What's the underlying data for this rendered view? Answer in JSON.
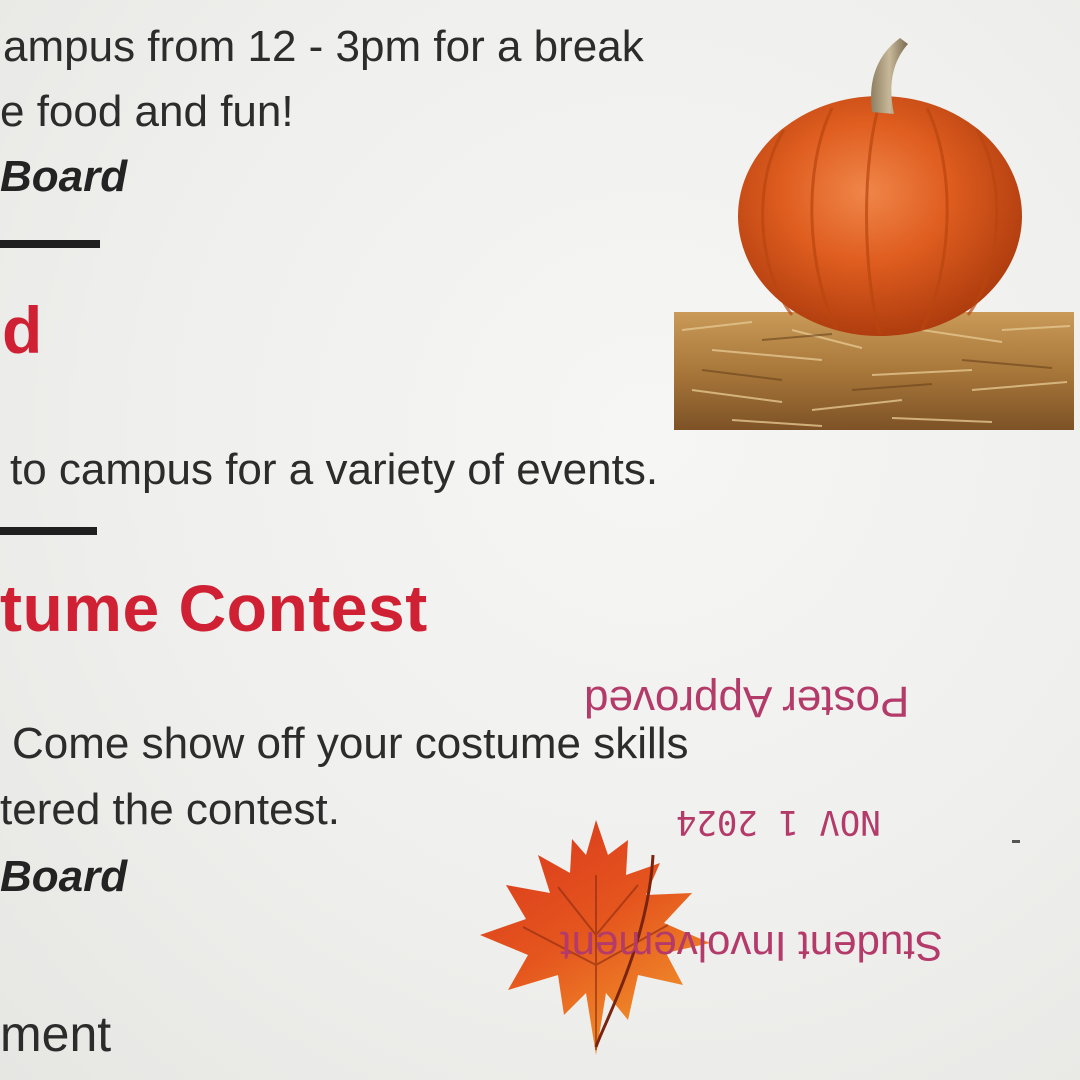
{
  "flyer": {
    "section1": {
      "line1": "ampus from 12 - 3pm for a break",
      "line2": "e food and fun!",
      "signature": "Board"
    },
    "section2": {
      "heading": "d",
      "line1": "to campus for a variety of events."
    },
    "section3": {
      "heading": "tume Contest",
      "line1": "Come show off your costume skills",
      "line2": "tered the contest.",
      "signature": "Board"
    },
    "footer_fragment": "ment"
  },
  "stamp": {
    "approval": "Poster Approved",
    "date": "NOV  1 2024",
    "office": "Student Involvement",
    "orientation": "upside-down",
    "color": "#b43a6a"
  },
  "images": {
    "pumpkin": "pumpkin-on-hay-bale",
    "leaf": "maple-leaf"
  },
  "colors": {
    "heading": "#cf2133",
    "body_text": "#2c2c2c",
    "paper": "#f2f2f0"
  }
}
